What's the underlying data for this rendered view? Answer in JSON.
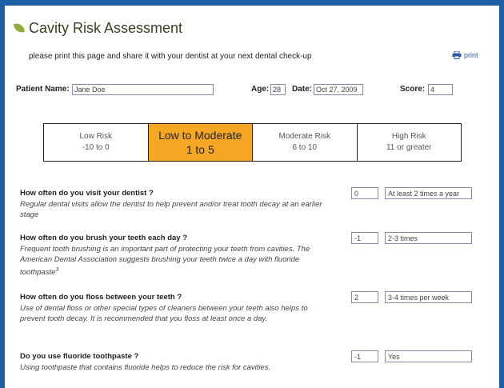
{
  "title": "Cavity Risk Assessment",
  "print_note": "please print this page and share it with your dentist at your next dental check-up",
  "print_label": "print",
  "patient": {
    "name_label": "Patient Name:",
    "name_value": "Jane Doe",
    "age_label": "Age:",
    "age_value": "28",
    "date_label": "Date:",
    "date_value": "Oct 27, 2009",
    "score_label": "Score:",
    "score_value": "4"
  },
  "risk_levels": [
    {
      "name": "Low Risk",
      "range": "-10 to 0"
    },
    {
      "name": "Low to Moderate",
      "range": "1 to 5"
    },
    {
      "name": "Moderate Risk",
      "range": "6 to 10"
    },
    {
      "name": "High Risk",
      "range": "11 or greater"
    }
  ],
  "active_risk": "Low to Moderate",
  "questions": [
    {
      "question": "How often do you visit your dentist ?",
      "description": "Regular dental visits allow the dentist to help prevent and/or treat tooth decay at an earlier stage",
      "score": "0",
      "answer": "At least 2 times a year"
    },
    {
      "question": "How often do you brush your teeth each day ?",
      "description": "Frequent tooth brushing is an important part of protecting your teeth from cavities. The American Dental Association suggests brushing your teeth twice a day with fluoride toothpaste",
      "description_sup": "3",
      "score": "-1",
      "answer": "2-3 times"
    },
    {
      "question": "How often do you floss between your teeth ?",
      "description": "Use of dental floss or other special types of cleaners between your teeth also helps to prevent tooth decay. It is recommended that you floss at least once a day.",
      "score": "2",
      "answer": "3-4 times per week"
    },
    {
      "question": "Do you use fluoride toothpaste ?",
      "description": "Using toothpaste that contains fluoride helps to reduce the risk for cavities.",
      "score": "-1",
      "answer": "Yes"
    }
  ]
}
